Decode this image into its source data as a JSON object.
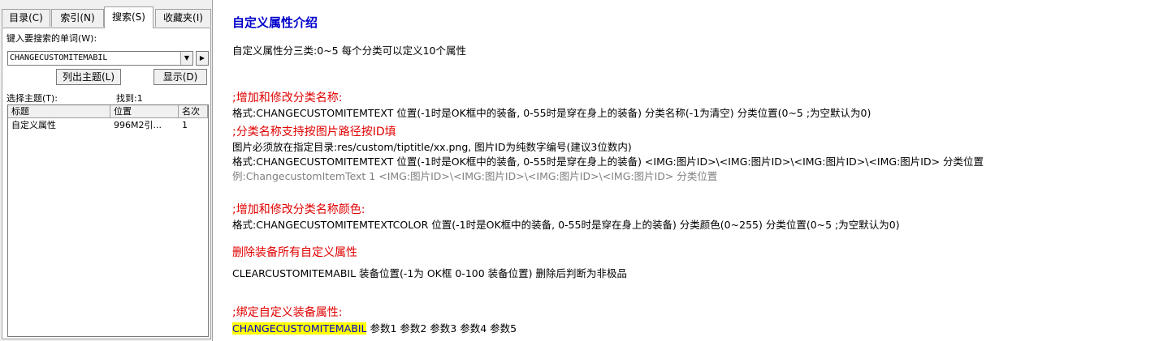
{
  "tabs": [
    "目录(C)",
    "索引(N)",
    "搜索(S)",
    "收藏夹(I)"
  ],
  "search": {
    "prompt_label": "键入要搜索的单词(W):",
    "keyword": "CHANGECUSTOMITEMABIL",
    "list_topics_button": "列出主题(L)",
    "display_button": "显示(D)",
    "select_topic_label": "选择主题(T):",
    "found_label": "找到:1",
    "columns": [
      "标题",
      "位置",
      "名次"
    ],
    "results": [
      {
        "title": "自定义属性",
        "location": "996M2引...",
        "rank": "1"
      }
    ]
  },
  "doc": {
    "title": "自定义属性介绍",
    "intro": "自定义属性分三类:0~5 每个分类可以定义10个属性",
    "s1_heading": ";增加和修改分类名称:",
    "s1_format": "格式:CHANGECUSTOMITEMTEXT 位置(-1时是OK框中的装备, 0-55时是穿在身上的装备) 分类名称(-1为清空)  分类位置(0~5 ;为空默认为0)",
    "s2_heading": ";分类名称支持按图片路径按ID填",
    "s2_line1": "图片必须放在指定目录:res/custom/tiptitle/xx.png, 图片ID为纯数字编号(建议3位数内)",
    "s2_format": "格式:CHANGECUSTOMITEMTEXT 位置(-1时是OK框中的装备, 0-55时是穿在身上的装备) <IMG:图片ID>\\<IMG:图片ID>\\<IMG:图片ID>\\<IMG:图片ID>  分类位置",
    "s2_example": "例:ChangecustomItemText 1 <IMG:图片ID>\\<IMG:图片ID>\\<IMG:图片ID>\\<IMG:图片ID>  分类位置",
    "s3_heading": ";增加和修改分类名称颜色:",
    "s3_format": "格式:CHANGECUSTOMITEMTEXTCOLOR 位置(-1时是OK框中的装备, 0-55时是穿在身上的装备) 分类颜色(0~255) 分类位置(0~5 ;为空默认为0)",
    "s4_heading": "删除装备所有自定义属性",
    "s4_line": "CLEARCUSTOMITEMABIL 装备位置(-1为 OK框 0-100 装备位置) 删除后判断为非极品",
    "s5_heading": ";绑定自定义装备属性:",
    "s5_cmd": "CHANGECUSTOMITEMABIL",
    "s5_params": " 参数1  参数2  参数3  参数4  参数5"
  }
}
